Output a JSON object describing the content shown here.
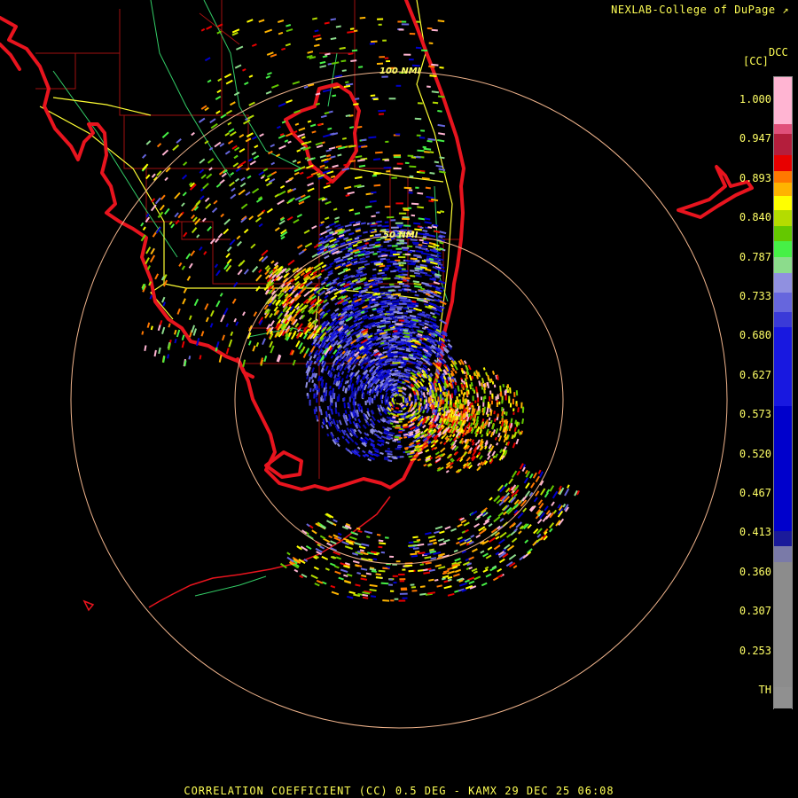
{
  "header": {
    "credit": "NEXLAB-College of DuPage ↗"
  },
  "footer": {
    "caption": "CORRELATION COEFFICIENT (CC) 0.5 DEG - KAMX 29 DEC 25 06:08"
  },
  "map": {
    "range_rings": [
      {
        "label": "50 NMI"
      },
      {
        "label": "100 NMI"
      }
    ]
  },
  "colorbar": {
    "product": "DCC",
    "unit": "[CC]",
    "ticks": [
      "1.000",
      "0.947",
      "0.893",
      "0.840",
      "0.787",
      "0.733",
      "0.680",
      "0.627",
      "0.573",
      "0.520",
      "0.467",
      "0.413",
      "0.360",
      "0.307",
      "0.253",
      "TH"
    ],
    "bands": [
      {
        "color": "#ffb4d2",
        "to": 1.0
      },
      {
        "color": "#e0507a",
        "to": 0.96
      },
      {
        "color": "#b41e3c",
        "to": 0.947
      },
      {
        "color": "#e80000",
        "to": 0.92
      },
      {
        "color": "#ff7800",
        "to": 0.9
      },
      {
        "color": "#ffb400",
        "to": 0.885
      },
      {
        "color": "#ffff00",
        "to": 0.868
      },
      {
        "color": "#b4dc00",
        "to": 0.85
      },
      {
        "color": "#64c800",
        "to": 0.83
      },
      {
        "color": "#46f046",
        "to": 0.81
      },
      {
        "color": "#8cdc8c",
        "to": 0.79
      },
      {
        "color": "#9090e0",
        "to": 0.77
      },
      {
        "color": "#6666dd",
        "to": 0.745
      },
      {
        "color": "#3a3ad8",
        "to": 0.72
      },
      {
        "color": "#1818e0",
        "to": 0.7
      },
      {
        "color": "#0000cc",
        "to": 0.6
      },
      {
        "color": "#1a1a9a",
        "to": 0.44
      },
      {
        "color": "#7a7aa8",
        "to": 0.42
      },
      {
        "color": "#8c8c8c",
        "to": 0.4
      },
      {
        "color": "#909090",
        "to": 0.24
      },
      {
        "color": "#000000",
        "to": 0.213
      }
    ]
  },
  "colors": {
    "coast": "#e8141e",
    "county": "#a01010",
    "highway": "#ffff33",
    "road": "#33cc66",
    "ring": "#f0b48c",
    "radar_site": "#000000"
  }
}
